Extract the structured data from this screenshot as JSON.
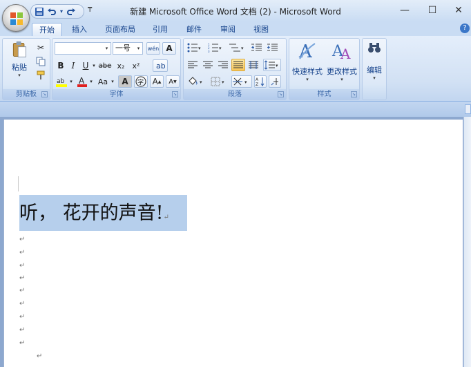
{
  "window": {
    "title": "新建 Microsoft Office Word 文档 (2) - Microsoft Word",
    "minimize": "—",
    "maximize": "☐",
    "close": "✕"
  },
  "qat": {
    "save_icon": "floppy-disk-icon",
    "undo_icon": "undo-icon",
    "undo_dd": "▾",
    "redo_icon": "redo-icon",
    "customize_caret": "₸"
  },
  "tabs": [
    {
      "label": "开始",
      "active": true
    },
    {
      "label": "插入"
    },
    {
      "label": "页面布局"
    },
    {
      "label": "引用"
    },
    {
      "label": "邮件"
    },
    {
      "label": "审阅"
    },
    {
      "label": "视图"
    }
  ],
  "ribbon": {
    "clipboard": {
      "label": "剪贴板",
      "paste_label": "粘贴"
    },
    "font": {
      "label": "字体",
      "font_name": "",
      "font_size": "一号",
      "wen_btn": "wén",
      "bold": "B",
      "italic": "I",
      "underline": "U",
      "strike": "abe",
      "subscript": "x₂",
      "superscript": "x²",
      "change_case": "Aa",
      "char_shading": "A",
      "enclose": "字",
      "grow": "A",
      "shrink": "A",
      "highlight": "ab"
    },
    "paragraph": {
      "label": "段落"
    },
    "styles": {
      "label": "样式",
      "quick_styles": "快速样式",
      "change_styles": "更改样式"
    },
    "editing": {
      "label": "编辑"
    }
  },
  "document": {
    "line1": "听，  花开的声音!",
    "para_mark": "↵",
    "empty_paragraphs": 8
  }
}
